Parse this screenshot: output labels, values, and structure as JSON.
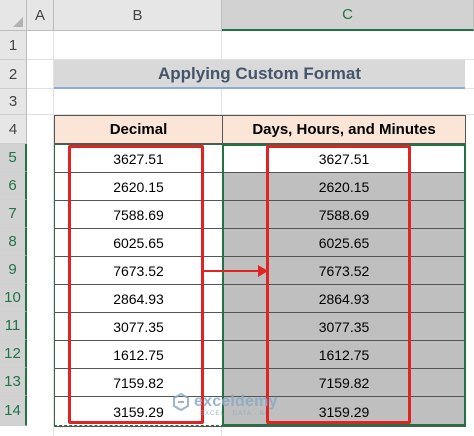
{
  "sheet": {
    "columns": [
      "A",
      "B",
      "C"
    ],
    "selected_column": "C",
    "rows": [
      "1",
      "2",
      "3",
      "4",
      "5",
      "6",
      "7",
      "8",
      "9",
      "10",
      "11",
      "12",
      "13",
      "14"
    ]
  },
  "title": "Applying Custom Format",
  "table": {
    "headers": [
      "Decimal",
      "Days, Hours, and Minutes"
    ],
    "decimal": [
      "3627.51",
      "2620.15",
      "7588.69",
      "6025.65",
      "7673.52",
      "2864.93",
      "3077.35",
      "1612.75",
      "7159.82",
      "3159.29"
    ],
    "result": [
      "3627.51",
      "2620.15",
      "7588.69",
      "6025.65",
      "7673.52",
      "2864.93",
      "3077.35",
      "1612.75",
      "7159.82",
      "3159.29"
    ]
  },
  "watermark": {
    "name": "exceldemy",
    "tagline": "EXCEL · DATA · BI"
  },
  "colors": {
    "header_fill": "#fbe5d6",
    "title_fill": "#d9d9d9",
    "title_text": "#44546a",
    "highlight_red": "#e02424",
    "selection_green": "#217346"
  }
}
